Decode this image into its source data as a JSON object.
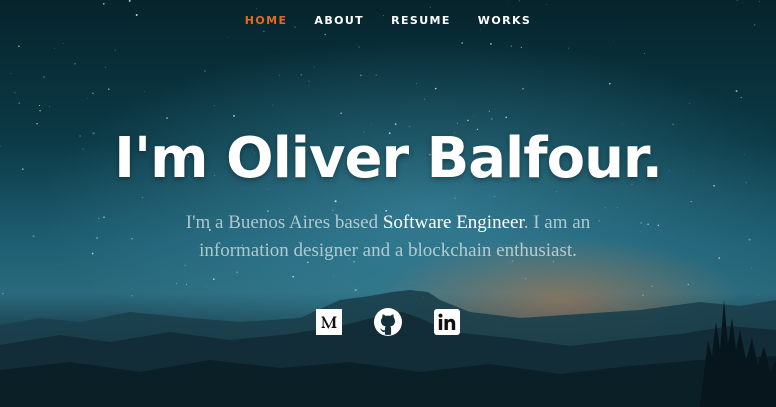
{
  "nav": {
    "items": [
      {
        "label": "HOME",
        "active": true
      },
      {
        "label": "ABOUT",
        "active": false
      },
      {
        "label": "RESUME",
        "active": false
      },
      {
        "label": "WORKS",
        "active": false
      }
    ]
  },
  "hero": {
    "title": "I'm Oliver Balfour.",
    "intro_prefix": "I'm a Buenos Aires based ",
    "intro_highlight": "Software Engineer",
    "intro_suffix": ". I am an information designer and a blockchain enthusiast."
  },
  "social": {
    "icons": [
      "medium-icon",
      "github-icon",
      "linkedin-icon"
    ]
  },
  "colors": {
    "accent": "#e56b1c",
    "text": "#ffffff"
  }
}
